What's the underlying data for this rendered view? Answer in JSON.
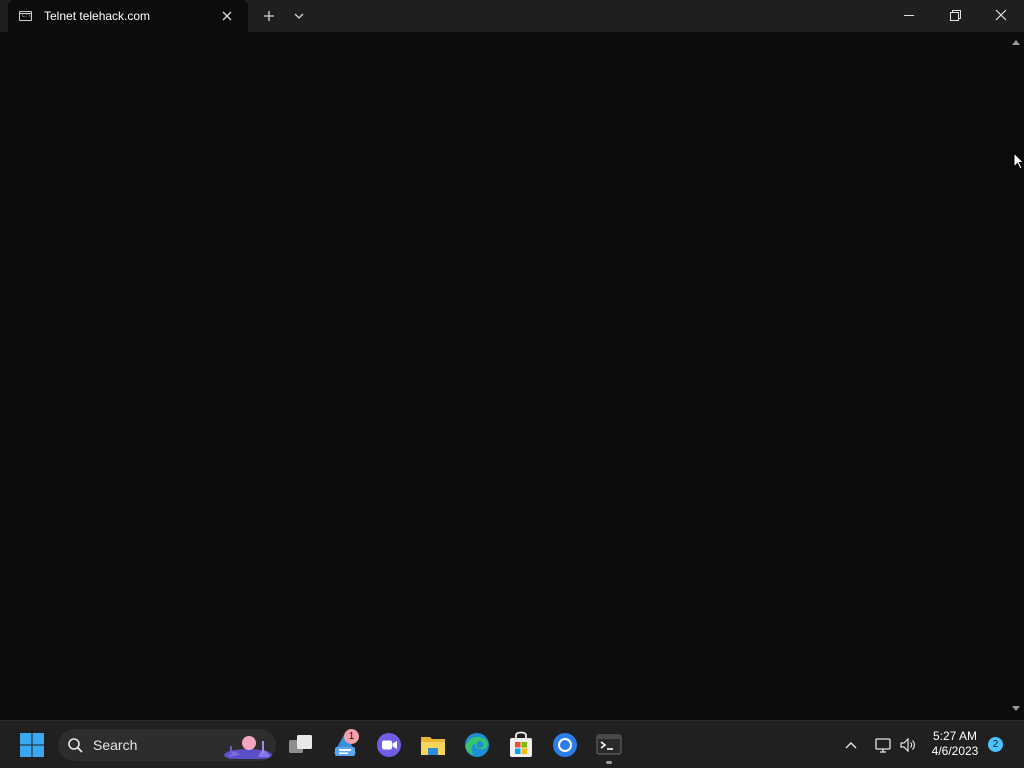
{
  "window": {
    "tab_title": "Telnet telehack.com",
    "tab_icon_text": "C:\\"
  },
  "taskbar": {
    "search_label": "Search",
    "apps": [
      {
        "name": "start",
        "icon": "windows-logo-icon"
      },
      {
        "name": "task-view",
        "icon": "task-view-icon"
      },
      {
        "name": "app-with-badge",
        "icon": "notes-app-icon",
        "badge": "1"
      },
      {
        "name": "teams",
        "icon": "teams-video-icon"
      },
      {
        "name": "file-explorer",
        "icon": "folder-icon"
      },
      {
        "name": "edge",
        "icon": "edge-browser-icon"
      },
      {
        "name": "microsoft-store",
        "icon": "store-icon"
      },
      {
        "name": "chrome",
        "icon": "chrome-icon"
      },
      {
        "name": "terminal",
        "icon": "terminal-icon",
        "active": true
      }
    ],
    "tray": {
      "time": "5:27 AM",
      "date": "4/6/2023",
      "notification_count": "2"
    }
  },
  "colors": {
    "terminal_bg": "#0c0c0c",
    "titlebar_bg": "#1f1f1f",
    "taskbar_bg": "#202020",
    "accent": "#4cc2ff"
  }
}
